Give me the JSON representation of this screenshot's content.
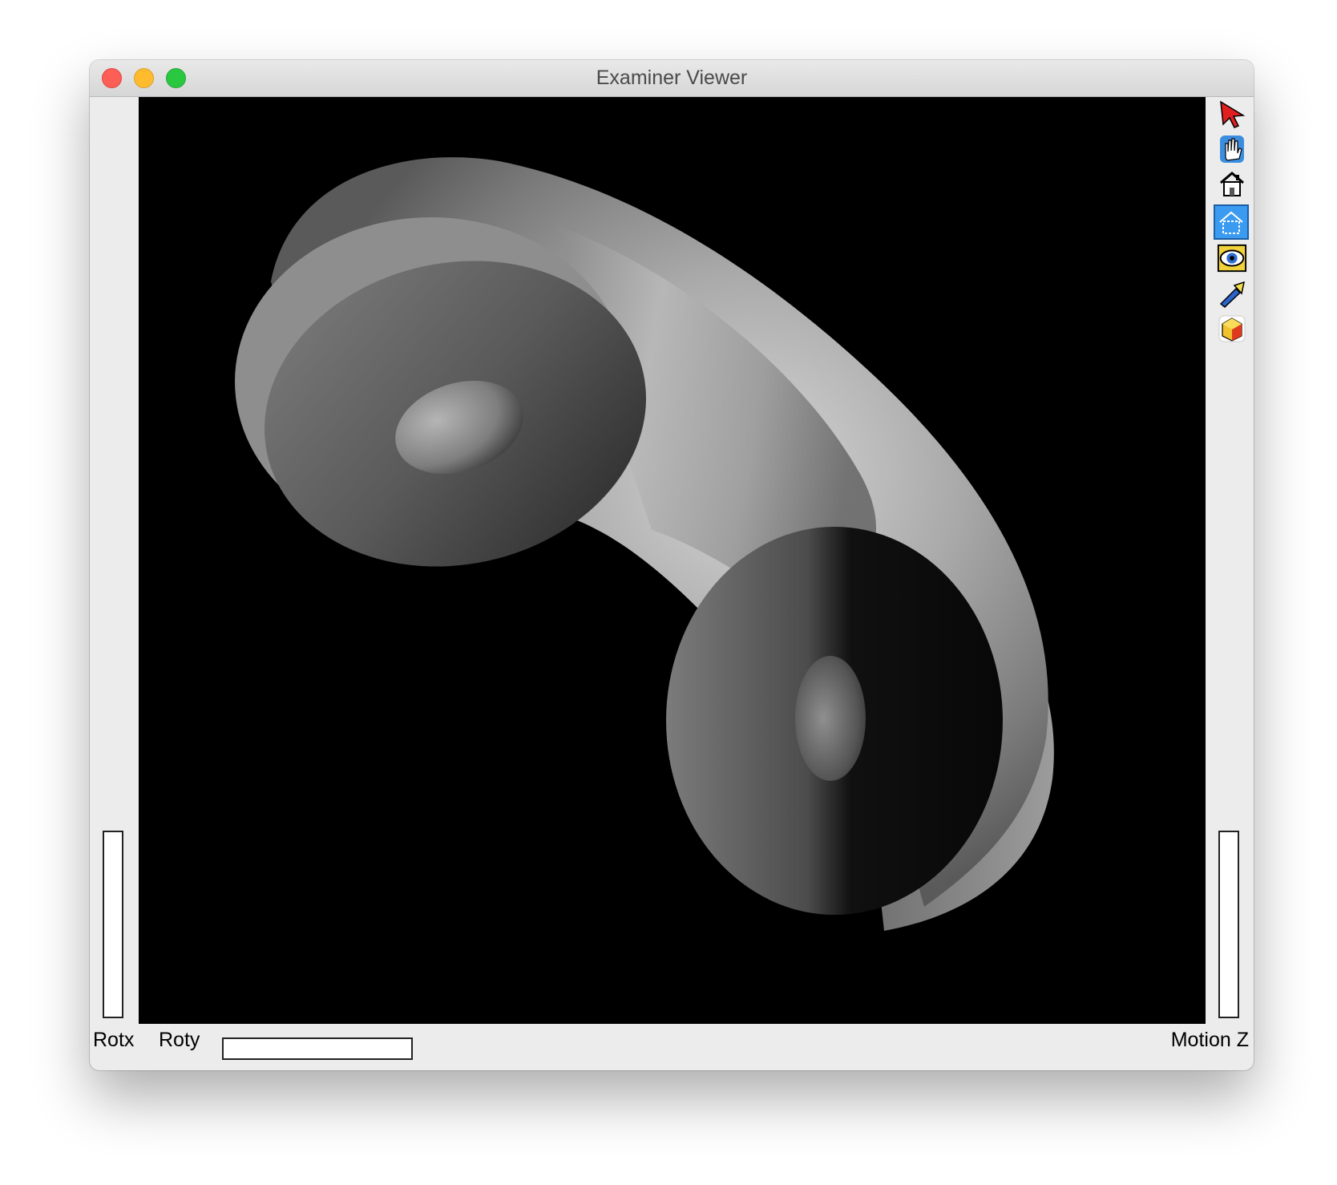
{
  "window": {
    "title": "Examiner Viewer"
  },
  "toolbar": {
    "tools": [
      {
        "name": "select-pointer-icon"
      },
      {
        "name": "view-hand-icon"
      },
      {
        "name": "home-icon"
      },
      {
        "name": "set-home-icon"
      },
      {
        "name": "view-all-icon"
      },
      {
        "name": "seek-flashlight-icon"
      },
      {
        "name": "perspective-cube-icon"
      }
    ]
  },
  "thumbwheels": {
    "rotx_label": "Rotx",
    "roty_label": "Roty",
    "motion_z_label": "Motion Z"
  },
  "scene": {
    "background_color": "#000000",
    "object": "grey shaded curved tube with two ring-shaped ends"
  }
}
